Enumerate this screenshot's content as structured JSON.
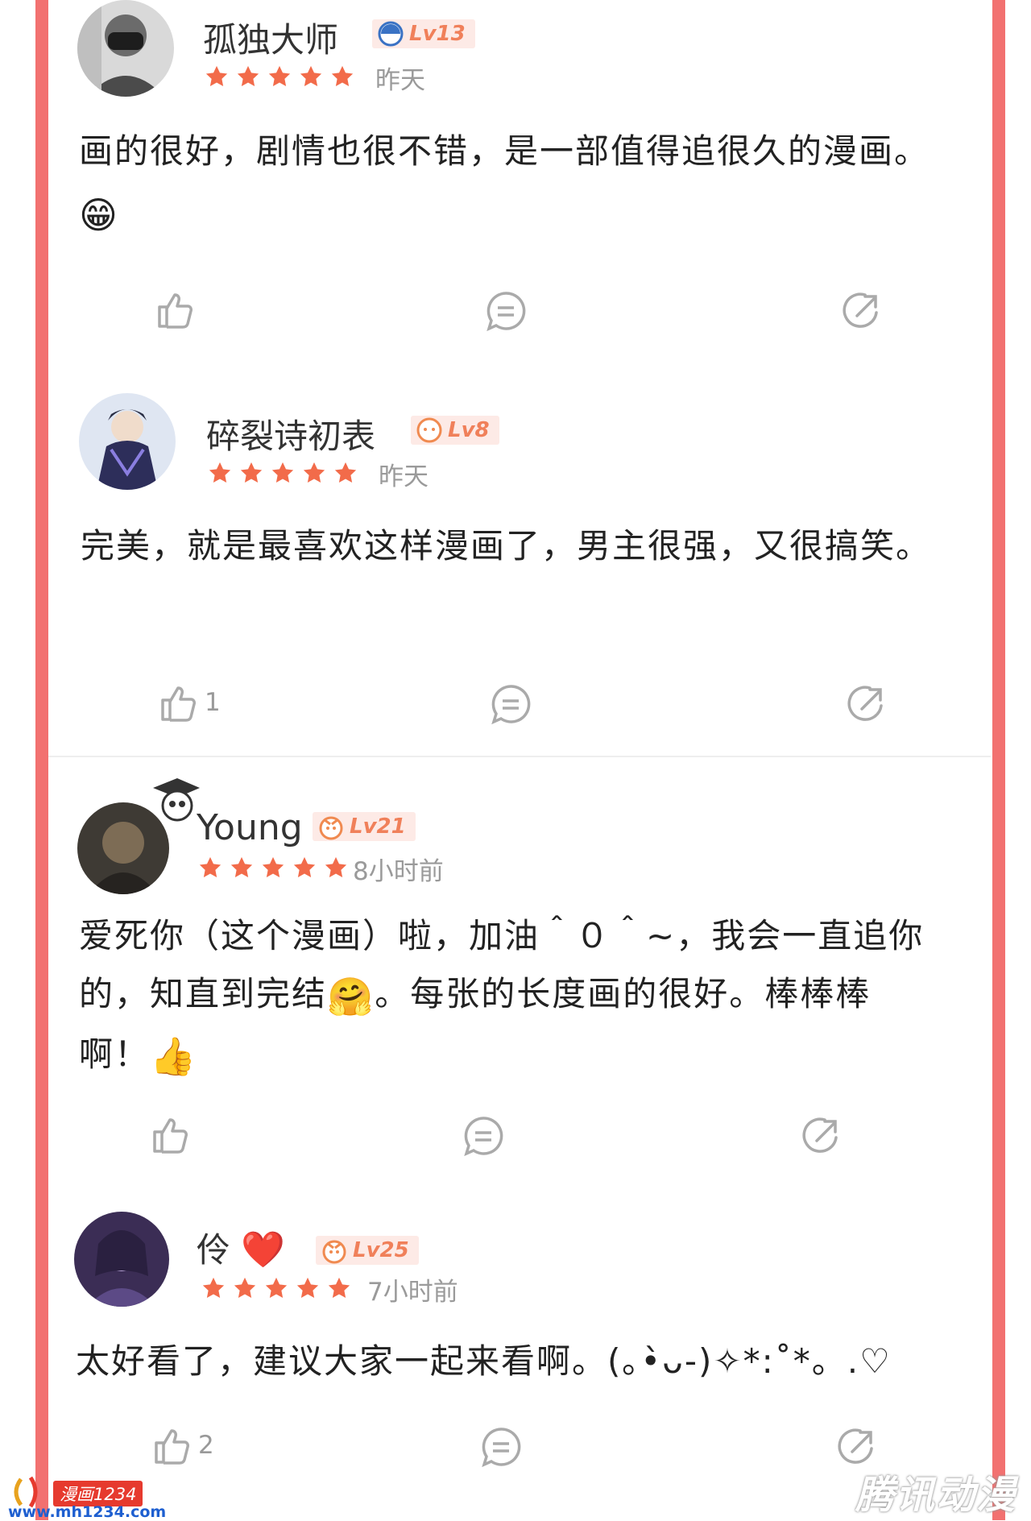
{
  "comments": [
    {
      "username": "孤独大师",
      "level": "Lv13",
      "time": "昨天",
      "text": "画的很好，剧情也很不错，是一部值得追很久的漫画。",
      "text_emoji": "😁",
      "rating": 5,
      "like_count": "",
      "icons": {
        "like": "thumbs-up-icon",
        "reply": "comment-bubble-icon",
        "share": "share-arrow-icon"
      }
    },
    {
      "username": "碎裂诗初表",
      "level": "Lv8",
      "time": "昨天",
      "text": "完美，就是最喜欢这样漫画了，男主很强，又很搞笑。",
      "text_emoji": "",
      "rating": 5,
      "like_count": "1"
    },
    {
      "username": "Young",
      "level": "Lv21",
      "time": "8小时前",
      "text_part1": "爱死你（这个漫画）啦，加油＾０＾~，我会一直追你的，知直到完结",
      "text_emoji1": "🤗",
      "text_part2": "。每张的长度画的很好。棒棒棒啊！",
      "text_emoji2": "👍",
      "rating": 5,
      "like_count": ""
    },
    {
      "username": "伶",
      "username_emoji": "❤️",
      "level": "Lv25",
      "time": "7小时前",
      "text": "太好看了，建议大家一起来看啊。(｡•̀ᴗ-)✧*:˚*。.♡",
      "rating": 5,
      "like_count": "2"
    }
  ],
  "watermarks": {
    "left_brand": "漫画1234",
    "left_url": "www.mh1234.com",
    "right": "腾讯动漫"
  },
  "colors": {
    "border": "#f27170",
    "star": "#f26b4a",
    "level_bg": "#fdeae6",
    "level_text": "#f0805a"
  }
}
